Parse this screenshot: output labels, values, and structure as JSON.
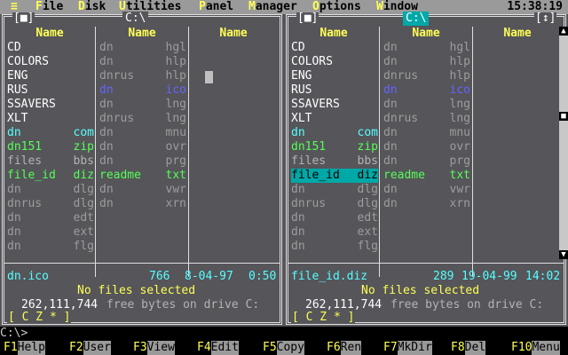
{
  "menubar": {
    "system": "≡",
    "items": [
      {
        "hk": "F",
        "rest": "ile"
      },
      {
        "hk": "D",
        "rest": "isk"
      },
      {
        "hk": "U",
        "rest": "tilities"
      },
      {
        "hk": "P",
        "rest": "anel"
      },
      {
        "hk": "M",
        "rest": "anager"
      },
      {
        "hk": "O",
        "rest": "ptions"
      },
      {
        "hk": "W",
        "rest": "indow"
      }
    ],
    "clock": "15:38:19"
  },
  "left_panel": {
    "title": "C:\\",
    "close_btn": "[■]",
    "col_header": "Name",
    "columns": [
      [
        {
          "n": "CD",
          "e": "",
          "c": "white"
        },
        {
          "n": "COLORS",
          "e": "",
          "c": "white"
        },
        {
          "n": "ENG",
          "e": "",
          "c": "white"
        },
        {
          "n": "RUS",
          "e": "",
          "c": "white"
        },
        {
          "n": "SSAVERS",
          "e": "",
          "c": "white"
        },
        {
          "n": "XLT",
          "e": "",
          "c": "white"
        },
        {
          "n": "dn",
          "e": "com",
          "c": "cyan"
        },
        {
          "n": "dn151",
          "e": "zip",
          "c": "green"
        },
        {
          "n": "files",
          "e": "bbs",
          "c": "lgray"
        },
        {
          "n": "file_id",
          "e": "diz",
          "c": "green"
        },
        {
          "n": "dn",
          "e": "dlg",
          "c": "dgray"
        },
        {
          "n": "dnrus",
          "e": "dlg",
          "c": "dgray"
        },
        {
          "n": "dn",
          "e": "edt",
          "c": "dgray"
        },
        {
          "n": "dn",
          "e": "ext",
          "c": "dgray"
        },
        {
          "n": "dn",
          "e": "flg",
          "c": "dgray"
        }
      ],
      [
        {
          "n": "dn",
          "e": "hgl",
          "c": "dgray"
        },
        {
          "n": "dn",
          "e": "hlp",
          "c": "dgray"
        },
        {
          "n": "dnrus",
          "e": "hlp",
          "c": "dgray"
        },
        {
          "n": "dn",
          "e": "ico",
          "c": "blue"
        },
        {
          "n": "dn",
          "e": "lng",
          "c": "dgray"
        },
        {
          "n": "dnrus",
          "e": "lng",
          "c": "dgray"
        },
        {
          "n": "dn",
          "e": "mnu",
          "c": "dgray"
        },
        {
          "n": "dn",
          "e": "ovr",
          "c": "dgray"
        },
        {
          "n": "dn",
          "e": "prg",
          "c": "dgray"
        },
        {
          "n": "readme",
          "e": "txt",
          "c": "green"
        },
        {
          "n": "dn",
          "e": "vwr",
          "c": "dgray"
        },
        {
          "n": "dn",
          "e": "xrn",
          "c": "dgray"
        }
      ],
      []
    ],
    "info_name": "dn.ico",
    "info_size": "766",
    "info_date": "8-04-97",
    "info_time": "0:50",
    "selected_msg": "No files selected",
    "free_num": "262,111,744",
    "free_text": "free bytes on drive C:",
    "drives": "[ C Z * ]"
  },
  "right_panel": {
    "title": "C:\\",
    "close_btn": "[■]",
    "zoom_btn": "[↕]",
    "col_header": "Name",
    "columns": [
      [
        {
          "n": "CD",
          "e": "",
          "c": "white"
        },
        {
          "n": "COLORS",
          "e": "",
          "c": "white"
        },
        {
          "n": "ENG",
          "e": "",
          "c": "white"
        },
        {
          "n": "RUS",
          "e": "",
          "c": "white"
        },
        {
          "n": "SSAVERS",
          "e": "",
          "c": "white"
        },
        {
          "n": "XLT",
          "e": "",
          "c": "white"
        },
        {
          "n": "dn",
          "e": "com",
          "c": "cyan"
        },
        {
          "n": "dn151",
          "e": "zip",
          "c": "green"
        },
        {
          "n": "files",
          "e": "bbs",
          "c": "lgray"
        },
        {
          "n": "file_id",
          "e": "diz",
          "c": "sel"
        },
        {
          "n": "dn",
          "e": "dlg",
          "c": "dgray"
        },
        {
          "n": "dnrus",
          "e": "dlg",
          "c": "dgray"
        },
        {
          "n": "dn",
          "e": "edt",
          "c": "dgray"
        },
        {
          "n": "dn",
          "e": "ext",
          "c": "dgray"
        },
        {
          "n": "dn",
          "e": "flg",
          "c": "dgray"
        }
      ],
      [
        {
          "n": "dn",
          "e": "hgl",
          "c": "dgray"
        },
        {
          "n": "dn",
          "e": "hlp",
          "c": "dgray"
        },
        {
          "n": "dnrus",
          "e": "hlp",
          "c": "dgray"
        },
        {
          "n": "dn",
          "e": "ico",
          "c": "blue"
        },
        {
          "n": "dn",
          "e": "lng",
          "c": "dgray"
        },
        {
          "n": "dnrus",
          "e": "lng",
          "c": "dgray"
        },
        {
          "n": "dn",
          "e": "mnu",
          "c": "dgray"
        },
        {
          "n": "dn",
          "e": "ovr",
          "c": "dgray"
        },
        {
          "n": "dn",
          "e": "prg",
          "c": "dgray"
        },
        {
          "n": "readme",
          "e": "txt",
          "c": "green"
        },
        {
          "n": "dn",
          "e": "vwr",
          "c": "dgray"
        },
        {
          "n": "dn",
          "e": "xrn",
          "c": "dgray"
        }
      ],
      []
    ],
    "info_name": "file_id.diz",
    "info_size": "289",
    "info_date": "19-04-99",
    "info_time": "14:02",
    "selected_msg": "No files selected",
    "free_num": "262,111,744",
    "free_text": "free bytes on drive C:",
    "drives": "[ C Z * ]"
  },
  "cmdline": "C:\\>",
  "keybar": [
    {
      "k": "F1",
      "l": "Help"
    },
    {
      "k": "F2",
      "l": "User"
    },
    {
      "k": "F3",
      "l": "View"
    },
    {
      "k": "F4",
      "l": "Edit"
    },
    {
      "k": "F5",
      "l": "Copy"
    },
    {
      "k": "F6",
      "l": "Ren"
    },
    {
      "k": "F7",
      "l": "MkDir"
    },
    {
      "k": "F8",
      "l": "Del"
    },
    {
      "k": "F10",
      "l": "Menu"
    }
  ],
  "colors": {
    "background": "#55555a",
    "menubar": "#9a9a9a",
    "hotkey": "#ffff55",
    "highlight": "#00a8a8"
  }
}
